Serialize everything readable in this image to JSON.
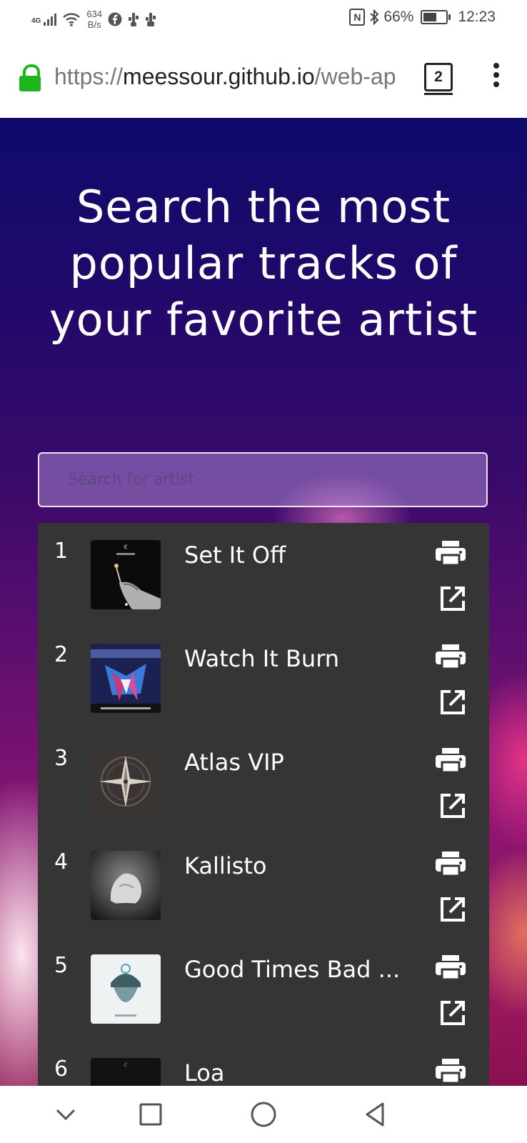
{
  "status_bar": {
    "network_type": "4G",
    "net_speed_value": "634",
    "net_speed_unit": "B/s",
    "notification_icons": [
      "facebook-icon",
      "usb-icon",
      "usb-debug-icon"
    ],
    "battery": "66%",
    "battery_level": 0.66,
    "time": "12:23"
  },
  "browser": {
    "url_scheme": "https://",
    "url_host": "meessour.github.io",
    "url_path": "/web-ap",
    "tab_count": "2"
  },
  "page": {
    "headline": "Search the most popular tracks of your favorite artist",
    "search": {
      "value": "",
      "placeholder": "Search for artist"
    },
    "tracks": [
      {
        "rank": "1",
        "title": "Set It Off"
      },
      {
        "rank": "2",
        "title": "Watch It Burn"
      },
      {
        "rank": "3",
        "title": "Atlas VIP"
      },
      {
        "rank": "4",
        "title": "Kallisto"
      },
      {
        "rank": "5",
        "title": "Good Times Bad ..."
      },
      {
        "rank": "6",
        "title": "Loa"
      }
    ]
  },
  "colors": {
    "gradient_top": "#0e0a6c",
    "gradient_bottom": "#8a1050",
    "list_background": "#353535",
    "lock_green": "#1fb51f"
  }
}
